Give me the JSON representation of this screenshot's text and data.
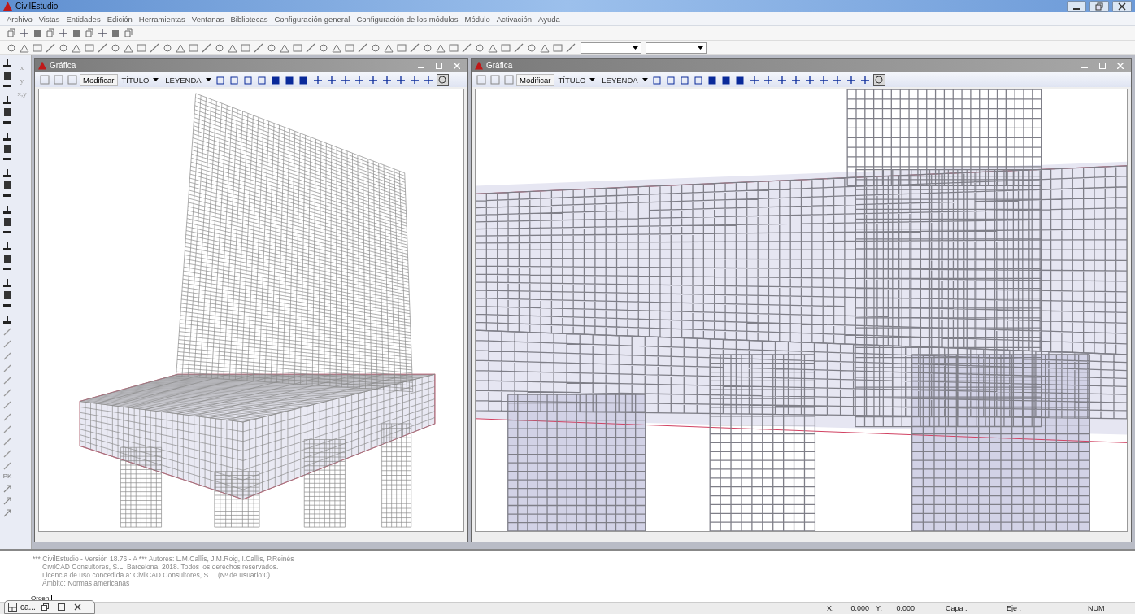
{
  "window": {
    "title": "CivilEstudio"
  },
  "menu": [
    "Archivo",
    "Vistas",
    "Entidades",
    "Edición",
    "Herramientas",
    "Ventanas",
    "Bibliotecas",
    "Configuración general",
    "Configuración de los módulos",
    "Módulo",
    "Activación",
    "Ayuda"
  ],
  "left_toolbar": {
    "axis_labels": [
      "x",
      "y",
      "x,y"
    ],
    "pk_label": "PK"
  },
  "graphic_windows": [
    {
      "title": "Gráfica",
      "modify_button": "Modificar",
      "title_dropdown": "TÍTULO",
      "legend_dropdown": "LEYENDA",
      "kind": "elevation"
    },
    {
      "title": "Gráfica",
      "modify_button": "Modificar",
      "title_dropdown": "TÍTULO",
      "legend_dropdown": "LEYENDA",
      "kind": "closeup"
    }
  ],
  "console": {
    "lines": [
      "*** CivilEstudio - Versión 18.76 - A *** Autores: L.M.Callís, J.M.Roig, I.Callís, P.Reinés",
      "CivilCAD Consultores, S.L. Barcelona, 2018. Todos los derechos reservados.",
      "Licencia de uso concedida a: CivilCAD Consultores, S.L.  (Nº de usuario:0)",
      "Ámbito: Normas americanas"
    ],
    "prompt": "Orden:"
  },
  "minimized_window": {
    "title": "ca..."
  },
  "status_bar": {
    "x_label": "X:",
    "x_value": "0.000",
    "y_label": "Y:",
    "y_value": "0.000",
    "layer_label": "Capa :",
    "axis_label": "Eje :",
    "num": "NUM"
  }
}
